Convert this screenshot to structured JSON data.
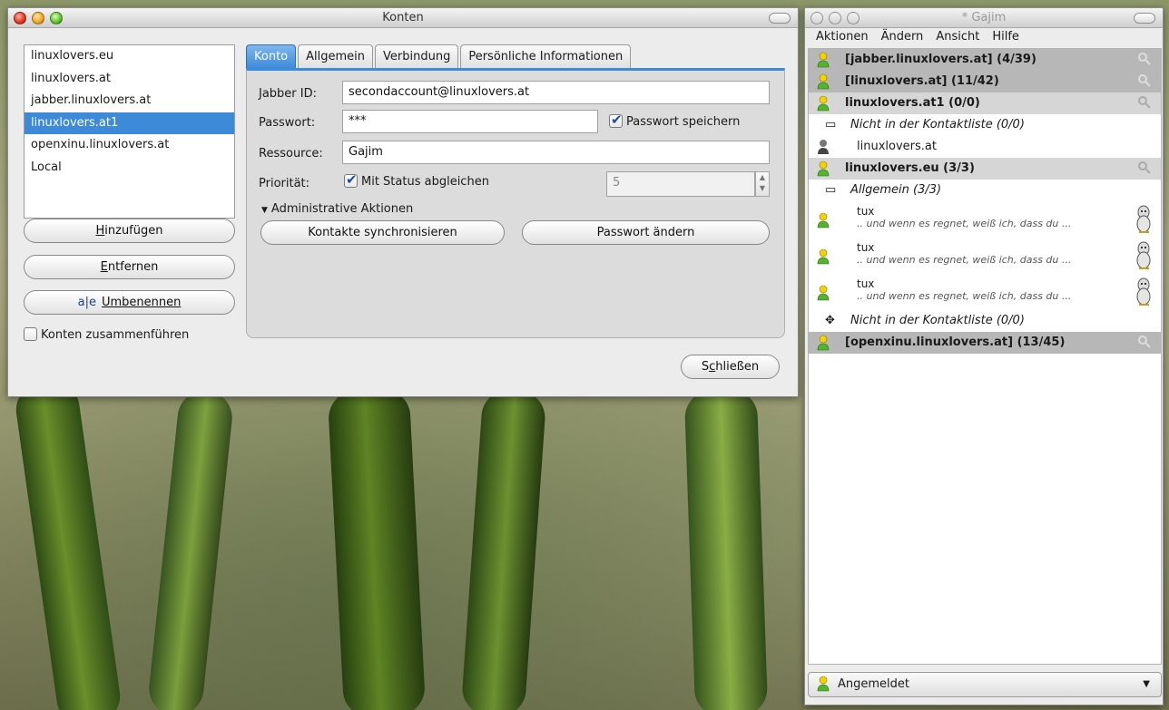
{
  "konten": {
    "title": "Konten",
    "accounts": [
      "linuxlovers.eu",
      "linuxlovers.at",
      "jabber.linuxlovers.at",
      "linuxlovers.at1",
      "openxinu.linuxlovers.at",
      "Local"
    ],
    "selected_index": 3,
    "buttons": {
      "add": "Hinzufügen",
      "remove": "Entfernen",
      "rename": "Umbenennen",
      "close": "Schließen"
    },
    "rename_icon_text": "a|e",
    "merge_label": "Konten zusammenführen",
    "tabs": [
      "Konto",
      "Allgemein",
      "Verbindung",
      "Persönliche Informationen"
    ],
    "form": {
      "jid_label": "Jabber ID:",
      "jid_value": "secondaccount@linuxlovers.at",
      "password_label": "Passwort:",
      "password_value": "***",
      "save_password_label": "Passwort speichern",
      "resource_label": "Ressource:",
      "resource_value": "Gajim",
      "priority_label": "Priorität:",
      "sync_status_label": "Mit Status abgleichen",
      "priority_value": "5",
      "admin_expander": "Administrative Aktionen",
      "sync_contacts": "Kontakte synchronisieren",
      "change_password": "Passwort ändern"
    }
  },
  "gajim": {
    "title": "* Gajim",
    "menu": [
      "Aktionen",
      "Ändern",
      "Ansicht",
      "Hilfe"
    ],
    "roster": {
      "acc1": "[jabber.linuxlovers.at] (4/39)",
      "acc2": "[linuxlovers.at] (11/42)",
      "acc3": "linuxlovers.at1 (0/0)",
      "grp1": "Nicht in der Kontaktliste (0/0)",
      "c1": "linuxlovers.at",
      "acc4": "linuxlovers.eu (3/3)",
      "grp2": "Allgemein (3/3)",
      "contacts": [
        {
          "name": "tux",
          "msg": ".. und wenn es regnet, weiß ich, dass du ..."
        },
        {
          "name": "tux",
          "msg": ".. und wenn es regnet, weiß ich, dass du ..."
        },
        {
          "name": "tux",
          "msg": ".. und wenn es regnet, weiß ich, dass du ..."
        }
      ],
      "grp3": "Nicht in der Kontaktliste (0/0)",
      "acc5": "[openxinu.linuxlovers.at] (13/45)"
    },
    "status": "Angemeldet"
  }
}
